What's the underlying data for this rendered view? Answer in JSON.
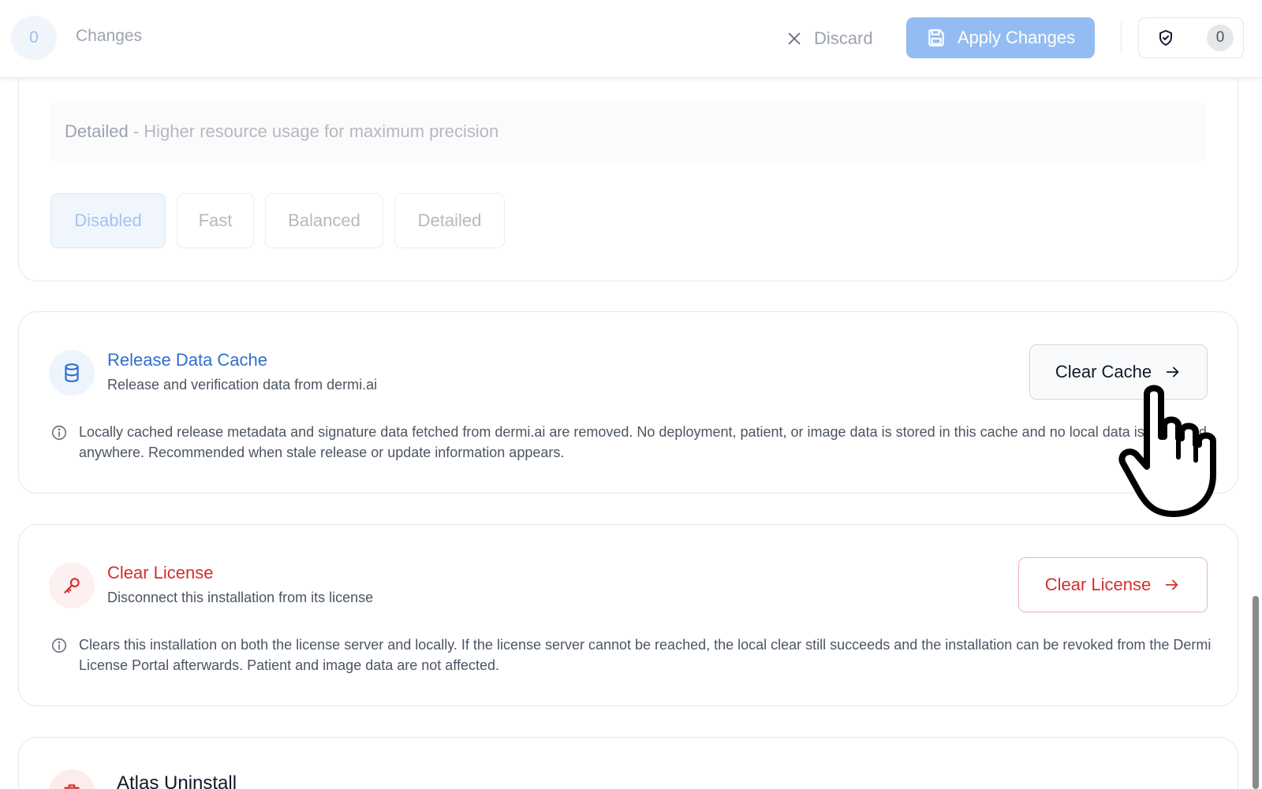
{
  "topbar": {
    "changes_count": "0",
    "changes_label": "Changes",
    "discard_label": "Discard",
    "apply_label": "Apply Changes",
    "shield_count": "0"
  },
  "analysis": {
    "detail_term": "Detailed",
    "detail_text": " - Higher resource usage for maximum precision",
    "modes": [
      {
        "label": "Disabled",
        "selected": true
      },
      {
        "label": "Fast",
        "selected": false
      },
      {
        "label": "Balanced",
        "selected": false
      },
      {
        "label": "Detailed",
        "selected": false
      }
    ]
  },
  "release_cache": {
    "title": "Release Data Cache",
    "subtitle": "Release and verification data from dermi.ai",
    "info": "Locally cached release metadata and signature data fetched from dermi.ai are removed. No deployment, patient, or image data is stored in this cache and no local data is uploaded anywhere. Recommended when stale release or update information appears.",
    "button_label": "Clear Cache",
    "accent": "#2f6fcf",
    "icon": "database-icon"
  },
  "clear_license": {
    "title": "Clear License",
    "subtitle": "Disconnect this installation from its license",
    "info": "Clears this installation on both the license server and locally. If the license server cannot be reached, the local clear still succeeds and the installation can be revoked from the Dermi License Portal afterwards. Patient and image data are not affected.",
    "button_label": "Clear License",
    "accent": "#d32f2f",
    "icon": "key-icon"
  },
  "uninstall": {
    "title": "Atlas Uninstall"
  }
}
